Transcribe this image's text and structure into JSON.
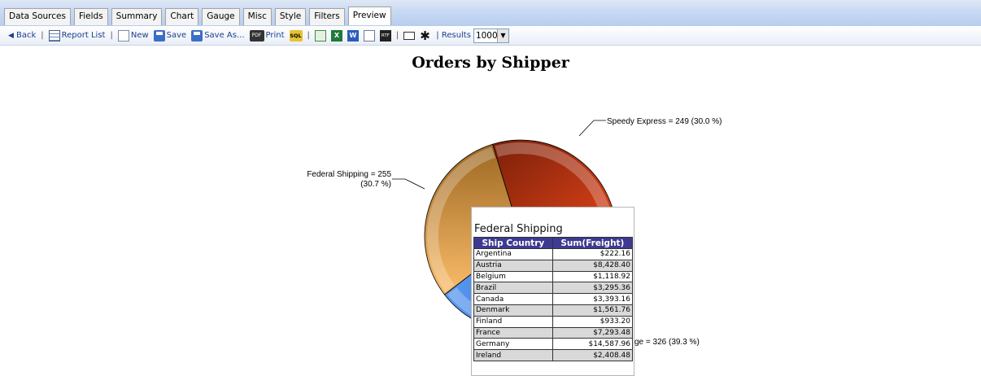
{
  "tabs": [
    {
      "label": "Data Sources",
      "active": false
    },
    {
      "label": "Fields",
      "active": false
    },
    {
      "label": "Summary",
      "active": false
    },
    {
      "label": "Chart",
      "active": false
    },
    {
      "label": "Gauge",
      "active": false
    },
    {
      "label": "Misc",
      "active": false
    },
    {
      "label": "Style",
      "active": false
    },
    {
      "label": "Filters",
      "active": false
    },
    {
      "label": "Preview",
      "active": true
    }
  ],
  "toolbar": {
    "back": "Back",
    "report_list": "Report List",
    "new": "New",
    "save": "Save",
    "save_as": "Save As...",
    "print": "Print",
    "sql_icon_text": "SQL",
    "pdf_icon_text": "PDF",
    "xls_icon_text": "X",
    "word_icon_text": "W",
    "rtf_icon_text": "RTF",
    "results_label": "| Results",
    "results_value": "1000",
    "separator": "|"
  },
  "icons": {
    "back": "back-arrow-icon",
    "report_list": "report-list-icon",
    "new": "new-document-icon",
    "save": "save-disk-icon",
    "save_as": "save-as-icon",
    "print": "print-pdf-icon",
    "sql": "sql-icon",
    "csv": "csv-export-icon",
    "excel": "excel-export-icon",
    "word": "word-export-icon",
    "html": "html-export-icon",
    "rtf": "rtf-export-icon",
    "email": "email-icon",
    "settings": "gear-icon"
  },
  "colors": {
    "tab_bar": "#c9daf3",
    "slice_speedy": "#cc3a10",
    "slice_federal": "#f7a944",
    "slice_united": "#3b7de0",
    "table_header": "#3e3a93"
  },
  "chart_data": {
    "type": "pie",
    "title": "Orders by Shipper",
    "slices": [
      {
        "name": "Speedy Express",
        "value": 249,
        "percent": 30.0,
        "color": "#cc3a10"
      },
      {
        "name": "United Package",
        "value": 326,
        "percent": 39.3,
        "color": "#3b7de0"
      },
      {
        "name": "Federal Shipping",
        "value": 255,
        "percent": 30.7,
        "color": "#f7a944"
      }
    ],
    "labels": {
      "speedy": "Speedy Express = 249 (30.0 %)",
      "federal_line1": "Federal Shipping = 255",
      "federal_line2": "(30.7 %)",
      "united_visible": "ge = 326 (39.3 %)"
    }
  },
  "tooltip": {
    "title": "Federal Shipping",
    "columns": [
      "Ship Country",
      "Sum(Freight)"
    ],
    "rows": [
      [
        "Argentina",
        "$222.16"
      ],
      [
        "Austria",
        "$8,428.40"
      ],
      [
        "Belgium",
        "$1,118.92"
      ],
      [
        "Brazil",
        "$3,295.36"
      ],
      [
        "Canada",
        "$3,393.16"
      ],
      [
        "Denmark",
        "$1,561.76"
      ],
      [
        "Finland",
        "$933.20"
      ],
      [
        "France",
        "$7,293.48"
      ],
      [
        "Germany",
        "$14,587.96"
      ],
      [
        "Ireland",
        "$2,408.48"
      ]
    ]
  }
}
